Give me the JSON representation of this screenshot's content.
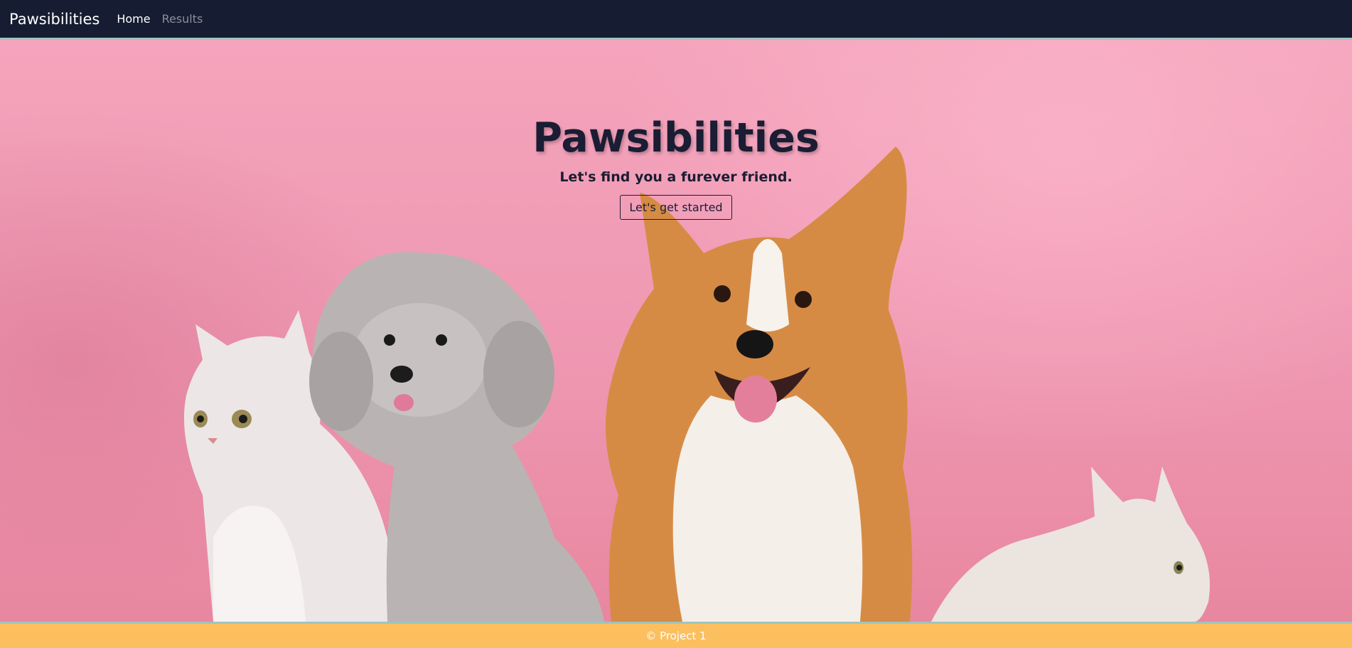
{
  "navbar": {
    "brand": "Pawsibilities",
    "links": [
      {
        "label": "Home",
        "active": true
      },
      {
        "label": "Results",
        "active": false
      }
    ],
    "background": "#161d32"
  },
  "hero": {
    "title": "Pawsibilities",
    "subtitle": "Let's find you a furever friend.",
    "button_label": "Let's get started",
    "background": "#f4a4bc",
    "image_subjects": [
      "white cat",
      "grey poodle",
      "corgi",
      "white cat"
    ]
  },
  "footer": {
    "text": "© Project 1",
    "background": "#fbbf5f"
  }
}
